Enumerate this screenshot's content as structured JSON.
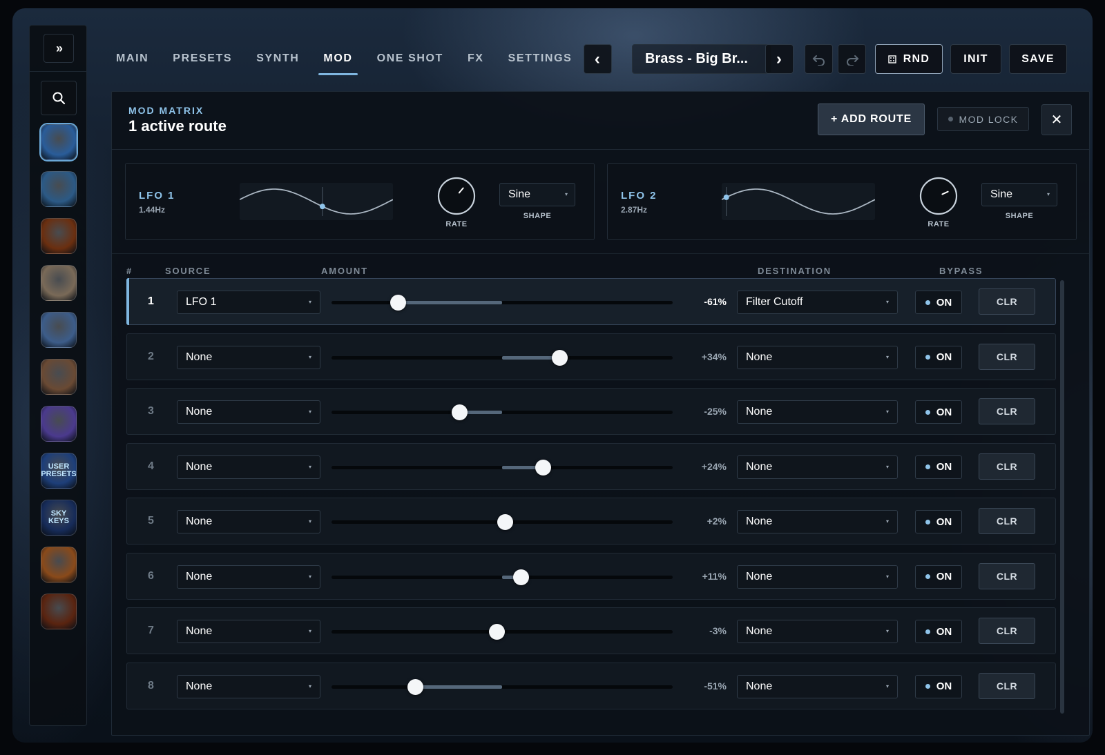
{
  "nav": {
    "tabs": [
      {
        "label": "MAIN"
      },
      {
        "label": "PRESETS"
      },
      {
        "label": "SYNTH"
      },
      {
        "label": "MOD"
      },
      {
        "label": "ONE SHOT"
      },
      {
        "label": "FX"
      },
      {
        "label": "SETTINGS"
      }
    ],
    "active_tab": "MOD",
    "preset_name": "Brass - Big Br...",
    "prev_glyph": "‹",
    "next_glyph": "›",
    "undo_icon": "undo-icon",
    "redo_icon": "redo-icon",
    "rnd_label": "RND",
    "init_label": "INIT",
    "save_label": "SAVE"
  },
  "sidebar": {
    "expand_glyph": "››",
    "thumbnails": [
      {
        "name": "preset-thumb-1",
        "color": "#2a5d9a"
      },
      {
        "name": "preset-thumb-2",
        "color": "#2c5a86"
      },
      {
        "name": "preset-thumb-3",
        "color": "#6b2f10"
      },
      {
        "name": "preset-thumb-4",
        "color": "#7a6a58"
      },
      {
        "name": "preset-thumb-5",
        "color": "#3d5d8a"
      },
      {
        "name": "preset-thumb-6",
        "color": "#6a4a34"
      },
      {
        "name": "preset-thumb-7",
        "color": "#4b3a8e"
      },
      {
        "name": "preset-thumb-8",
        "color": "#1e3f7a",
        "text": "USER PRESETS"
      },
      {
        "name": "preset-thumb-9",
        "color": "#172c5a",
        "text": "SKY KEYS"
      },
      {
        "name": "preset-thumb-10",
        "color": "#8a4a1a"
      },
      {
        "name": "preset-thumb-11",
        "color": "#5a2410"
      }
    ]
  },
  "mod_matrix": {
    "title": "MOD MATRIX",
    "subtitle": "1 active route",
    "add_route_label": "+ ADD ROUTE",
    "mod_lock_label": "MOD LOCK",
    "close_glyph": "✕"
  },
  "lfos": [
    {
      "name": "LFO 1",
      "freq": "1.44Hz",
      "rate_label": "RATE",
      "shape": "Sine",
      "shape_label": "SHAPE",
      "knob_angle": 40,
      "phase_marker": 0.54
    },
    {
      "name": "LFO 2",
      "freq": "2.87Hz",
      "rate_label": "RATE",
      "shape": "Sine",
      "shape_label": "SHAPE",
      "knob_angle": 65,
      "phase_marker": 0.03
    }
  ],
  "columns": {
    "num": "#",
    "source": "SOURCE",
    "amount": "AMOUNT",
    "destination": "DESTINATION",
    "bypass": "BYPASS"
  },
  "routes": [
    {
      "num": "1",
      "source": "LFO 1",
      "amount": -61,
      "amount_label": "-61%",
      "destination": "Filter Cutoff",
      "bypass": "ON",
      "clear": "CLR",
      "active": true
    },
    {
      "num": "2",
      "source": "None",
      "amount": 34,
      "amount_label": "+34%",
      "destination": "None",
      "bypass": "ON",
      "clear": "CLR",
      "active": false
    },
    {
      "num": "3",
      "source": "None",
      "amount": -25,
      "amount_label": "-25%",
      "destination": "None",
      "bypass": "ON",
      "clear": "CLR",
      "active": false
    },
    {
      "num": "4",
      "source": "None",
      "amount": 24,
      "amount_label": "+24%",
      "destination": "None",
      "bypass": "ON",
      "clear": "CLR",
      "active": false
    },
    {
      "num": "5",
      "source": "None",
      "amount": 2,
      "amount_label": "+2%",
      "destination": "None",
      "bypass": "ON",
      "clear": "CLR",
      "active": false
    },
    {
      "num": "6",
      "source": "None",
      "amount": 11,
      "amount_label": "+11%",
      "destination": "None",
      "bypass": "ON",
      "clear": "CLR",
      "active": false
    },
    {
      "num": "7",
      "source": "None",
      "amount": -3,
      "amount_label": "-3%",
      "destination": "None",
      "bypass": "ON",
      "clear": "CLR",
      "active": false
    },
    {
      "num": "8",
      "source": "None",
      "amount": -51,
      "amount_label": "-51%",
      "destination": "None",
      "bypass": "ON",
      "clear": "CLR",
      "active": false
    }
  ],
  "colors": {
    "accent": "#7fb6e0",
    "panel": "#0c1118",
    "bypass_dot": "#8fc4ea"
  }
}
